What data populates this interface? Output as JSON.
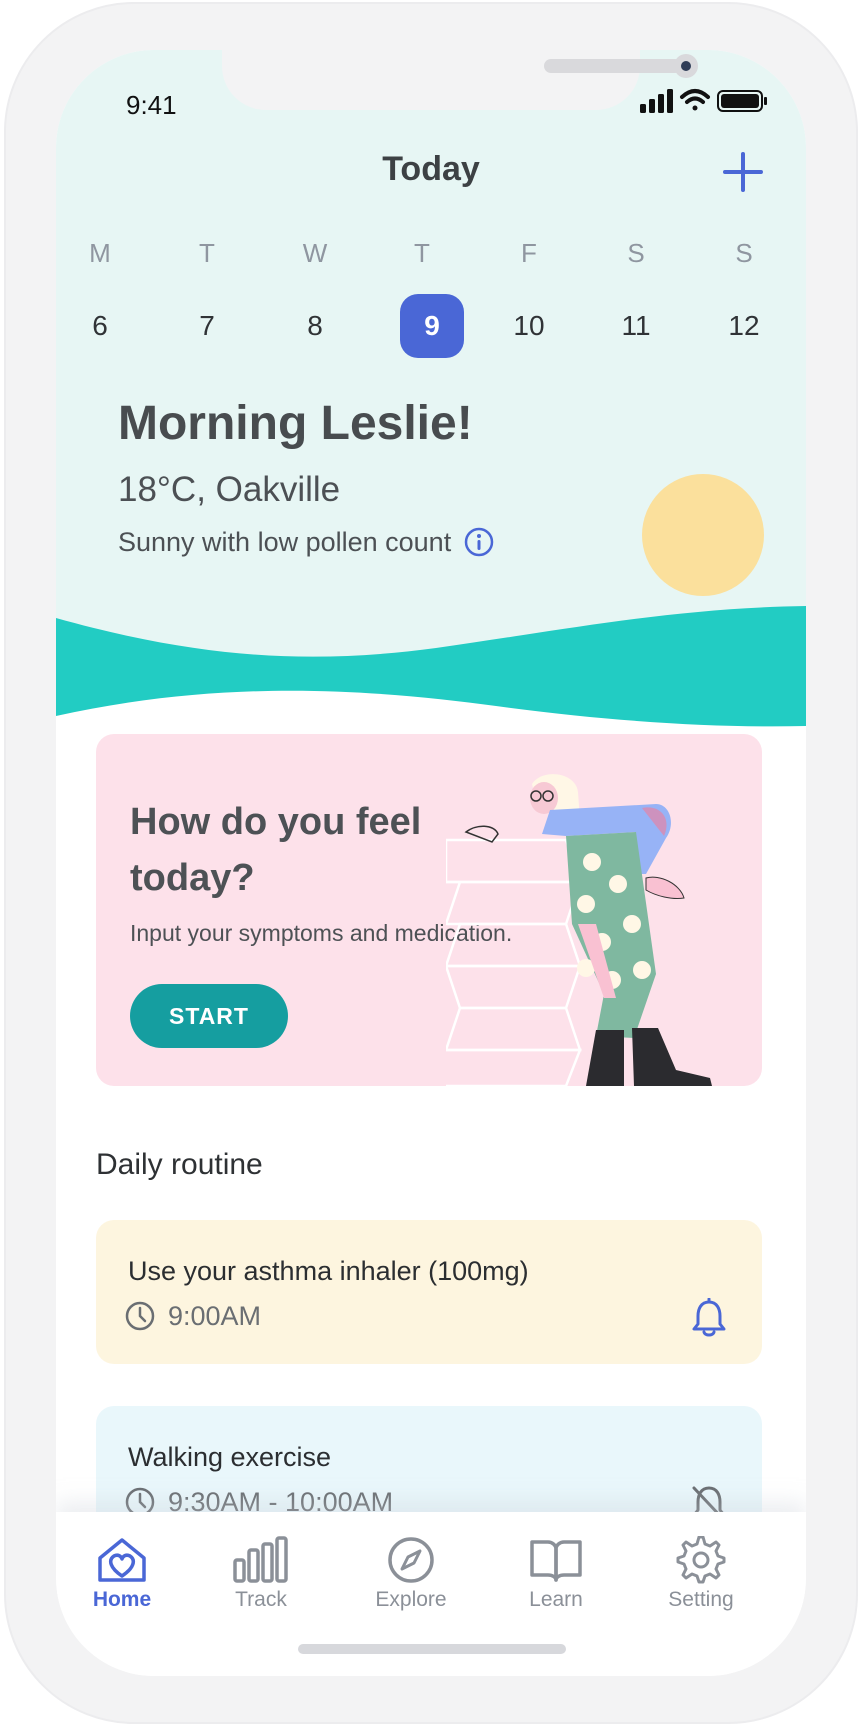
{
  "status_bar": {
    "time": "9:41"
  },
  "header": {
    "title": "Today",
    "add_icon": "plus-icon"
  },
  "week": {
    "days": [
      {
        "letter": "M",
        "date": "6"
      },
      {
        "letter": "T",
        "date": "7"
      },
      {
        "letter": "W",
        "date": "8"
      },
      {
        "letter": "T",
        "date": "9"
      },
      {
        "letter": "F",
        "date": "10"
      },
      {
        "letter": "S",
        "date": "11"
      },
      {
        "letter": "S",
        "date": "12"
      }
    ],
    "selected_date": "9"
  },
  "greeting": {
    "title": "Morning Leslie!",
    "temperature_location": "18°C, Oakville",
    "weather": "Sunny with low pollen count",
    "info_icon": "info-icon"
  },
  "feel_card": {
    "title": "How do you feel today?",
    "subtitle": "Input your symptoms and medication.",
    "start_label": "START"
  },
  "daily_routine": {
    "heading": "Daily routine",
    "items": [
      {
        "title": "Use your asthma inhaler (100mg)",
        "time": "9:00AM",
        "icon": "bell-icon",
        "background": "#fdf5df"
      },
      {
        "title": "Walking exercise",
        "time": "9:30AM - 10:00AM",
        "icon": "bell-off-icon",
        "background": "#e9f7fb"
      }
    ]
  },
  "nav": {
    "items": [
      {
        "label": "Home",
        "icon": "home-heart-icon",
        "active": true
      },
      {
        "label": "Track",
        "icon": "bar-chart-icon",
        "active": false
      },
      {
        "label": "Explore",
        "icon": "compass-icon",
        "active": false
      },
      {
        "label": "Learn",
        "icon": "book-icon",
        "active": false
      },
      {
        "label": "Setting",
        "icon": "gear-icon",
        "active": false
      }
    ]
  },
  "colors": {
    "accent": "#4a67d6",
    "teal": "#159ea0",
    "wave": "#22ccc3",
    "header_bg": "#e7f6f4",
    "feel_card_bg": "#fde1ea",
    "sun": "#fbe09c"
  }
}
